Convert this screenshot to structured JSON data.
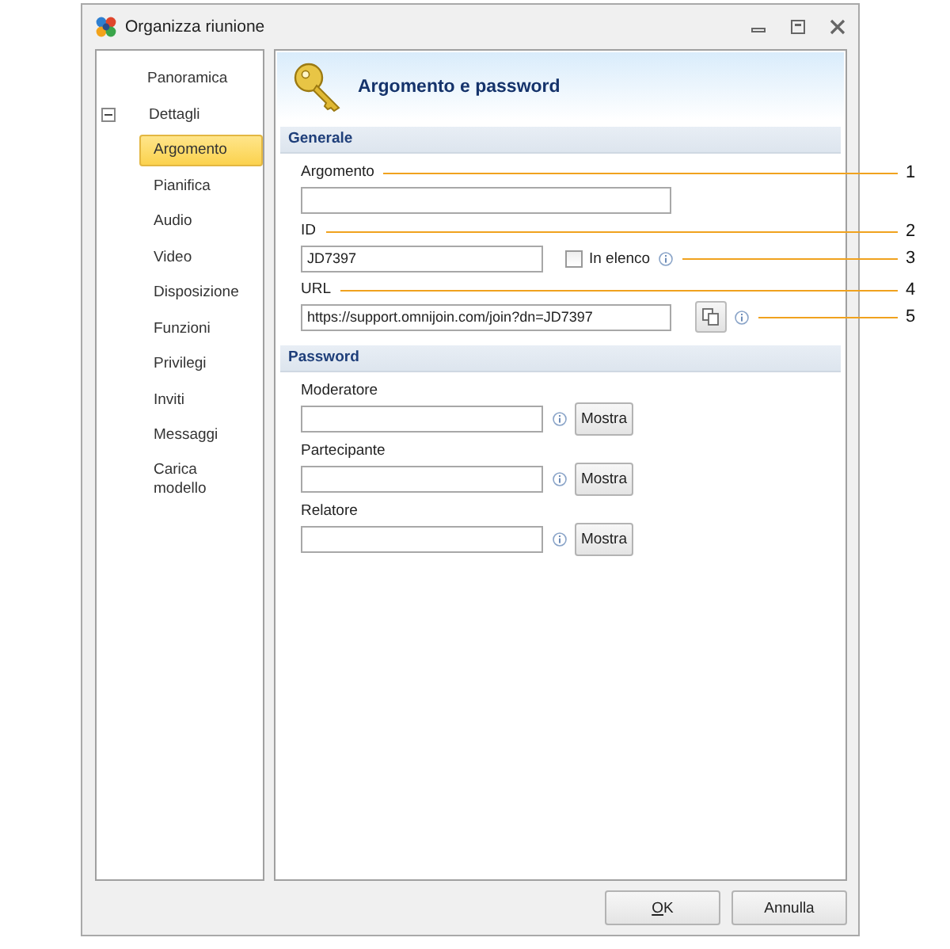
{
  "window": {
    "title": "Organizza riunione"
  },
  "nav": [
    {
      "label": "Panoramica",
      "selected": false
    },
    {
      "label": "Dettagli",
      "selected": false,
      "expanded": true,
      "children": [
        {
          "label": "Argomento",
          "selected": true
        },
        {
          "label": "Pianifica",
          "selected": false
        },
        {
          "label": "Audio",
          "selected": false
        },
        {
          "label": "Video",
          "selected": false
        },
        {
          "label": "Disposizione",
          "selected": false
        },
        {
          "label": "Funzioni",
          "selected": false
        },
        {
          "label": "Privilegi",
          "selected": false
        },
        {
          "label": "Inviti",
          "selected": false
        },
        {
          "label": "Messaggi",
          "selected": false
        },
        {
          "label": "Carica modello",
          "selected": false
        }
      ]
    }
  ],
  "header": {
    "title": "Argomento e password"
  },
  "sections": [
    {
      "title": "Generale",
      "fields": [
        {
          "kind": "text",
          "label": "Argomento",
          "label_callout": "1"
        },
        {
          "kind": "id",
          "label": "ID",
          "label_callout": "2",
          "value": "JD7397",
          "checkbox": {
            "label": "In elenco",
            "checked": false,
            "callout": "3"
          }
        },
        {
          "kind": "url",
          "label": "URL",
          "label_callout": "4",
          "value": "https://support.omnijoin.com/join?dn=JD7397",
          "info_callout": "5"
        }
      ]
    },
    {
      "title": "Password",
      "fields": [
        {
          "kind": "password",
          "label": "Moderatore",
          "button": "Mostra"
        },
        {
          "kind": "password",
          "label": "Partecipante",
          "button": "Mostra"
        },
        {
          "kind": "password",
          "label": "Relatore",
          "button": "Mostra"
        }
      ]
    }
  ],
  "buttons": [
    {
      "label": "OK",
      "underline_first": true
    },
    {
      "label": "Annulla",
      "underline_first": false
    }
  ]
}
